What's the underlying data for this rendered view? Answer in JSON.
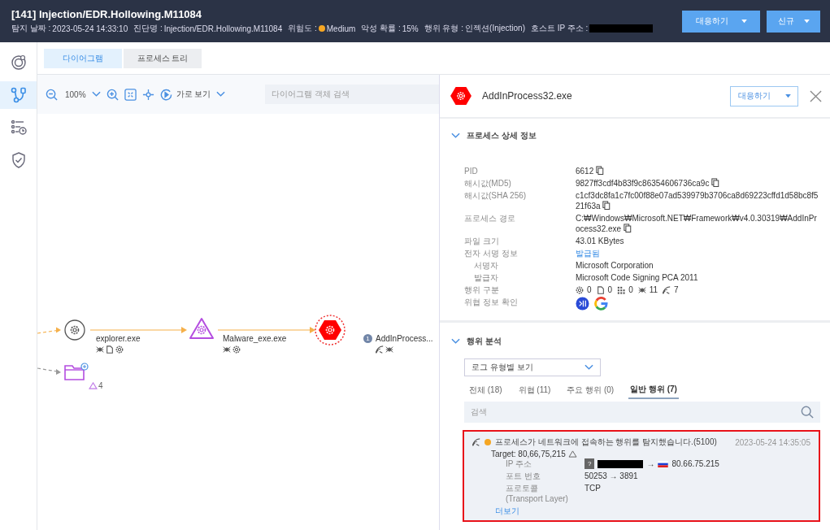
{
  "header": {
    "title": "[141] Injection/EDR.Hollowing.M11084",
    "meta": [
      {
        "kind": "text",
        "label": "탐지 날짜 :",
        "value": "2023-05-24 14:33:10"
      },
      {
        "kind": "text",
        "label": "진단명 :",
        "value": "Injection/EDR.Hollowing.M11084"
      },
      {
        "kind": "severity",
        "label": "위험도 :",
        "value": "Medium",
        "color": "#f5a623"
      },
      {
        "kind": "text",
        "label": "악성 확률 :",
        "value": "15%"
      },
      {
        "kind": "text",
        "label": "행위 유형 :",
        "value": "인젝션(Injection)"
      },
      {
        "kind": "redacted",
        "label": "호스트 IP 주소 :"
      }
    ],
    "buttons": [
      "대응하기",
      "신규"
    ]
  },
  "sidebar": {
    "items": [
      {
        "kind": "badge",
        "selected": false
      },
      {
        "kind": "diagram",
        "selected": true
      },
      {
        "kind": "list",
        "selected": false
      },
      {
        "kind": "shield",
        "selected": false
      }
    ]
  },
  "view_tabs": [
    {
      "label": "다이어그램",
      "selected": true
    },
    {
      "label": "프로세스 트리",
      "selected": false
    }
  ],
  "toolbar": {
    "zoom": "100%",
    "view": "가로 보기",
    "search_placeholder": "다이어그램 객체 검색"
  },
  "diagram": {
    "nodes": [
      {
        "kind": "process",
        "label": "explorer.exe"
      },
      {
        "kind": "malware",
        "label": "Malware_exe.exe"
      },
      {
        "kind": "target",
        "label": "AddInProcess...",
        "badge": "1"
      }
    ],
    "folder": {
      "count": "4"
    }
  },
  "detail": {
    "title": "AddInProcess32.exe",
    "button": "대응하기",
    "section_title": "프로세스 상세 정보",
    "rows": [
      {
        "kind": "text",
        "label": "PID",
        "value": "6612",
        "copy": true
      },
      {
        "kind": "text",
        "label": "해시값(MD5)",
        "value": "9827ff3cdf4b83f9c86354606736ca9c",
        "copy": true
      },
      {
        "kind": "text",
        "label": "해시값(SHA 256)",
        "value": "c1cf3dc8fa1c7fc00f88e07ad539979b3706ca8d69223cffd1d58bc8f521f63a",
        "copy": true
      },
      {
        "kind": "text",
        "label": "프로세스 경로",
        "value": "C:₩Windows₩Microsoft.NET₩Framework₩v4.0.30319₩AddInProcess32.exe",
        "copy": true
      },
      {
        "kind": "text",
        "label": "파일 크기",
        "value": "43.01 KBytes",
        "copy": false
      },
      {
        "kind": "link",
        "label": "전자 서명 정보",
        "value": "발급됨",
        "children": [
          {
            "label": "서명자",
            "value": "Microsoft Corporation"
          },
          {
            "label": "발급자",
            "value": "Microsoft Code Signing PCA 2011"
          }
        ]
      },
      {
        "kind": "counts",
        "label": "행위 구분",
        "counts": [
          {
            "kind": "process",
            "count": "0"
          },
          {
            "kind": "file",
            "count": "0"
          },
          {
            "kind": "registry",
            "count": "0"
          },
          {
            "kind": "network",
            "count": "11"
          },
          {
            "kind": "wifi",
            "count": "7"
          }
        ]
      },
      {
        "kind": "services",
        "label": "위협 정보 확인"
      }
    ]
  },
  "analysis": {
    "title": "행위 분석",
    "select": "로그 유형별 보기",
    "tabs": [
      {
        "label": "전체 (18)",
        "selected": false
      },
      {
        "label": "위협 (11)",
        "selected": false
      },
      {
        "label": "주요 행위 (0)",
        "selected": false
      },
      {
        "label": "일반 행위 (7)",
        "selected": true
      }
    ],
    "search_placeholder": "검색",
    "events": [
      {
        "message": "프로세스가 네트워크에 접속하는 행위를 탐지했습니다.(5100)",
        "time": "2023-05-24 14:35:05",
        "color": "#f5a623",
        "target": "Target: 80,66,75,215",
        "highlighted": true,
        "details": [
          {
            "kind": "ip",
            "label": "IP 주소",
            "badge": "?",
            "arrow": "→",
            "value": "80.66.75.215"
          },
          {
            "kind": "text",
            "label": "포트 번호",
            "value": "50253 → 3891"
          },
          {
            "kind": "text",
            "label": "프로토콜(Transport Layer)",
            "value": "TCP"
          }
        ],
        "more": "더보기"
      }
    ]
  }
}
